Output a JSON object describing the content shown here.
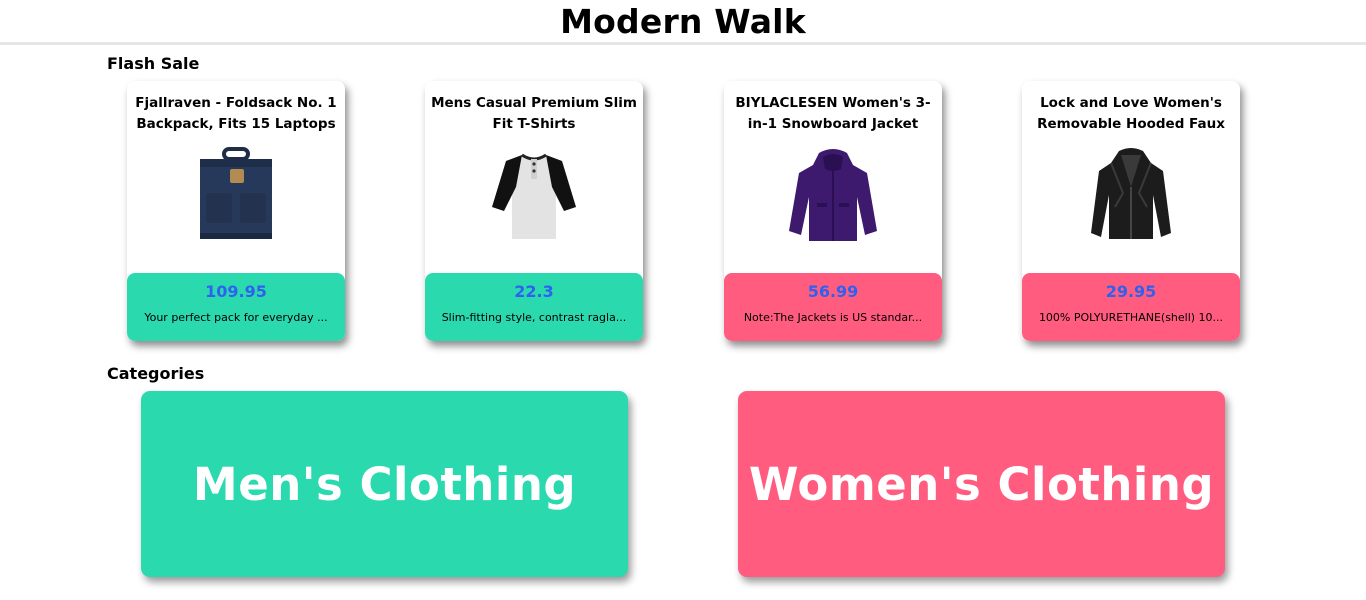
{
  "app": {
    "title": "Modern Walk"
  },
  "flash_sale": {
    "title": "Flash Sale",
    "products": [
      {
        "title": "Fjallraven - Foldsack No. 1 Backpack, Fits 15 Laptops",
        "price": "109.95",
        "description": "Your perfect pack for everyday ...",
        "color": "#2bd9ae",
        "icon": "backpack-icon"
      },
      {
        "title": "Mens Casual Premium Slim Fit T-Shirts",
        "price": "22.3",
        "description": "Slim-fitting style, contrast ragla...",
        "color": "#2bd9ae",
        "icon": "tshirt-icon"
      },
      {
        "title": "BIYLACLESEN Women's 3-in-1 Snowboard Jacket",
        "price": "56.99",
        "description": "Note:The Jackets is US standar...",
        "color": "#ff5c80",
        "icon": "jacket-icon"
      },
      {
        "title": "Lock and Love Women's Removable Hooded Faux",
        "price": "29.95",
        "description": "100% POLYURETHANE(shell) 10...",
        "color": "#ff5c80",
        "icon": "leather-jacket-icon"
      }
    ]
  },
  "categories": {
    "title": "Categories",
    "items": [
      {
        "label": "Men's Clothing",
        "color": "#2bd9ae"
      },
      {
        "label": "Women's Clothing",
        "color": "#ff5c80"
      }
    ]
  },
  "colors": {
    "men": "#2bd9ae",
    "women": "#ff5c80",
    "price": "#2e61f0"
  }
}
